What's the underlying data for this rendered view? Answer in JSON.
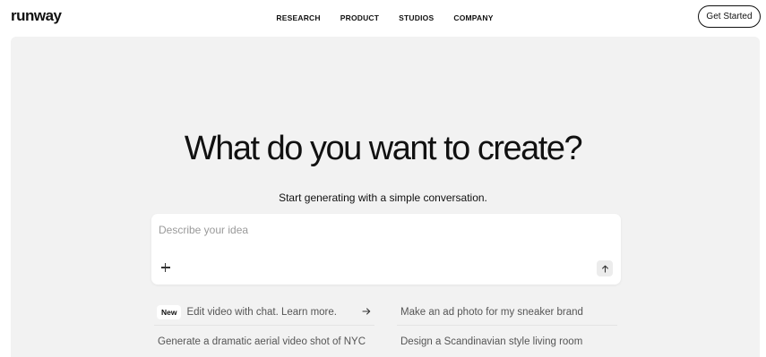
{
  "header": {
    "logo": "runway",
    "nav": [
      "RESEARCH",
      "PRODUCT",
      "STUDIOS",
      "COMPANY"
    ],
    "cta_label": "Get Started"
  },
  "hero": {
    "title": "What do you want to create?",
    "subtitle": "Start generating with a simple conversation."
  },
  "prompt": {
    "placeholder": "Describe your idea",
    "value": ""
  },
  "suggestions": [
    {
      "badge": "New",
      "text": "Edit video with chat. Learn more.",
      "has_arrow": true
    },
    {
      "text": "Make an ad photo for my sneaker brand"
    },
    {
      "text": "Generate a dramatic aerial video shot of NYC"
    },
    {
      "text": "Design a Scandinavian style living room"
    }
  ],
  "icons": {
    "attach": "plus-icon",
    "submit": "arrow-up-icon",
    "suggestion_arrow": "arrow-right-icon"
  },
  "colors": {
    "panel_bg": "#f2f2f2",
    "text": "#111111",
    "muted_text": "#555555",
    "placeholder": "#9a9a9a"
  }
}
